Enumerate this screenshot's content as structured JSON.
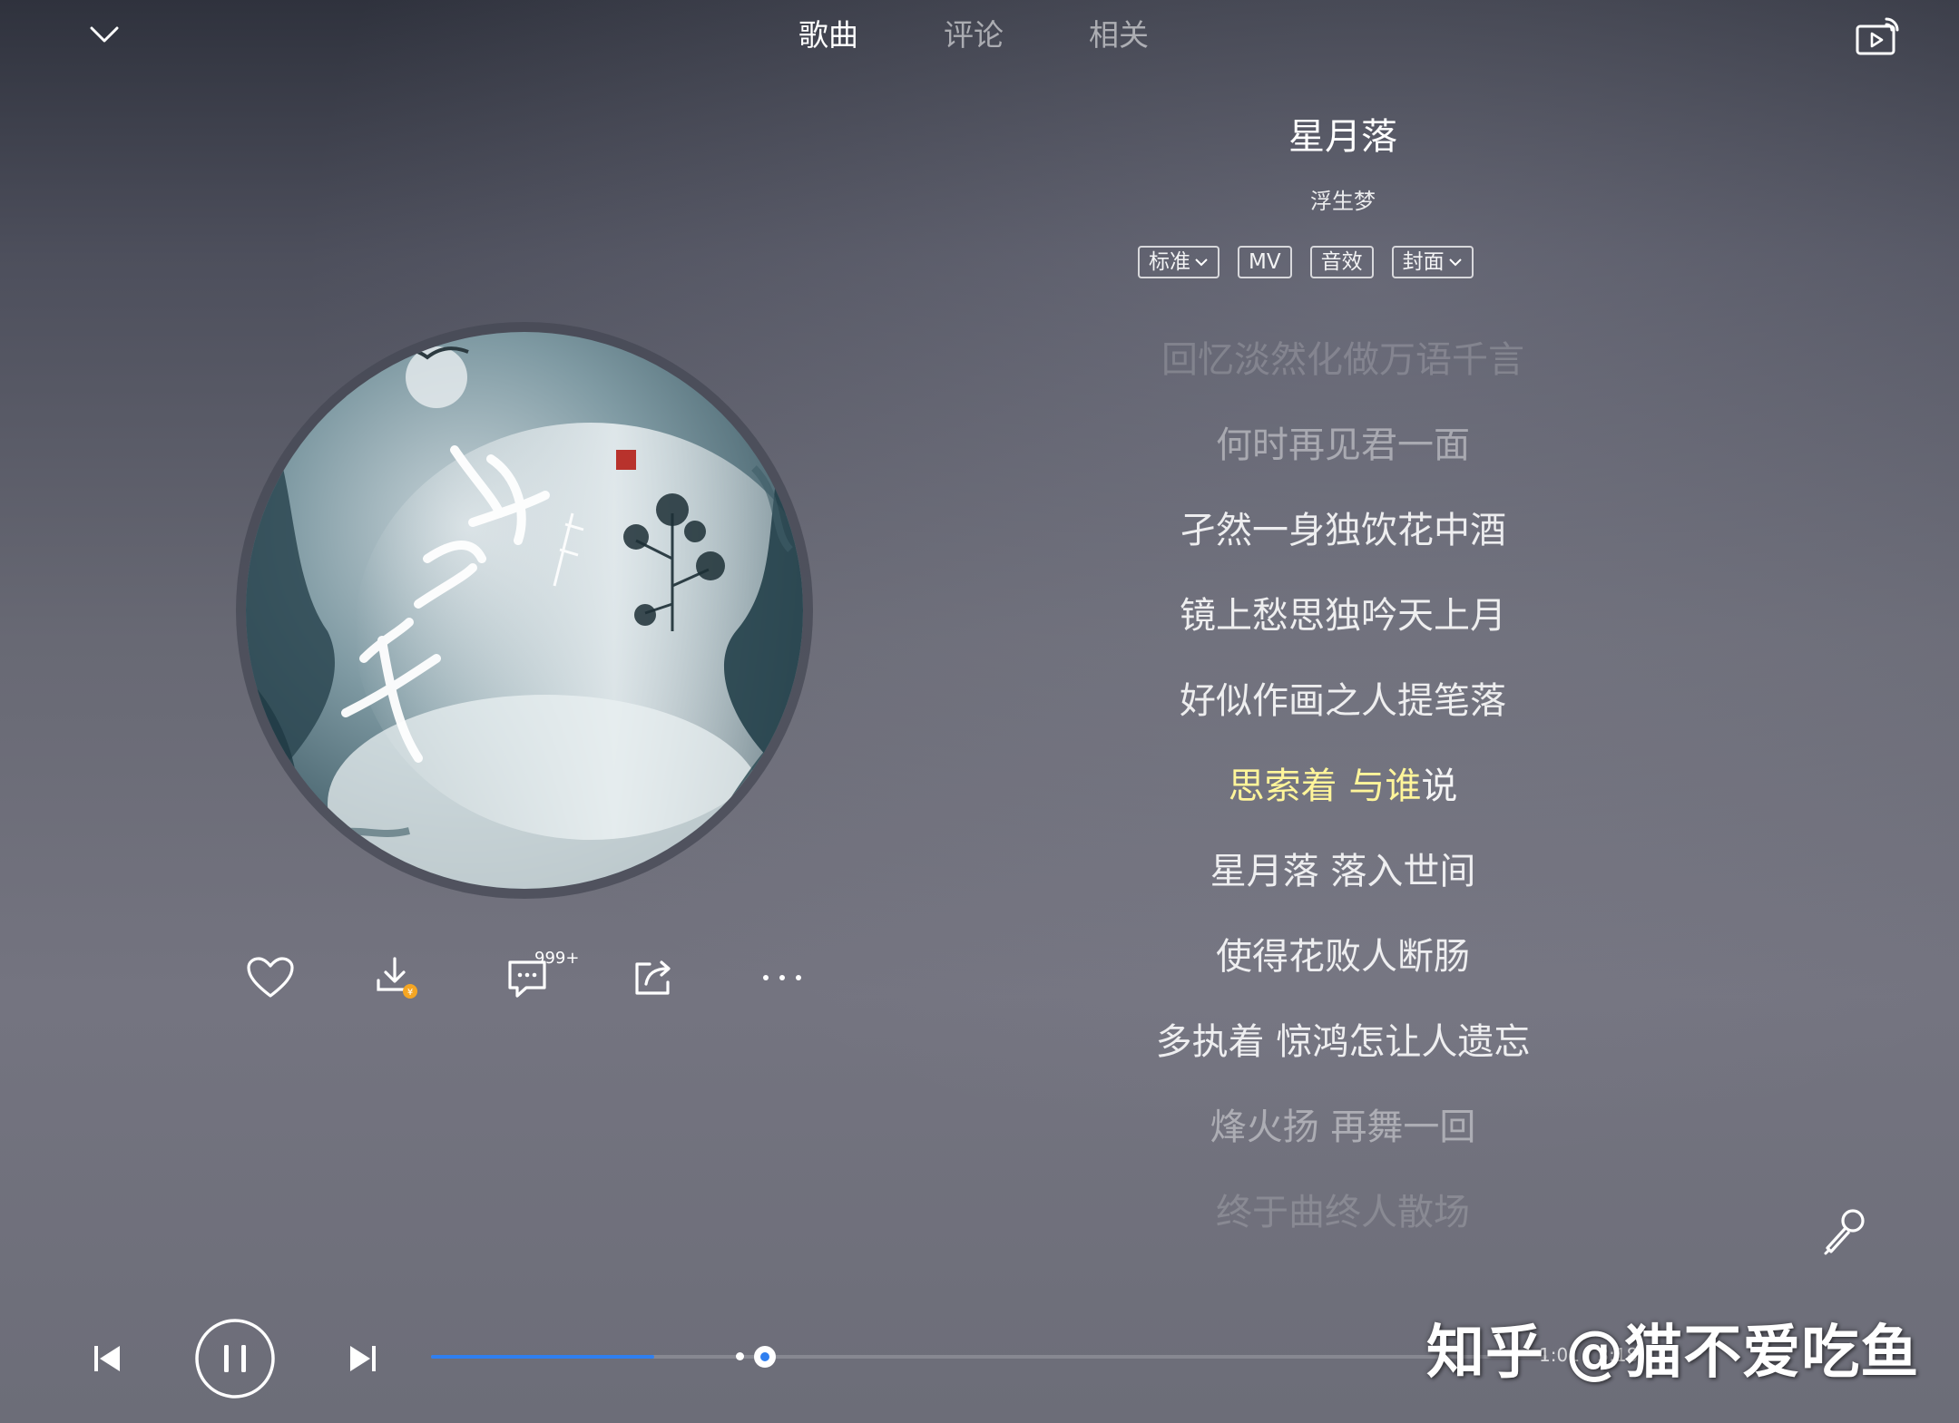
{
  "top_bar": {
    "tabs": [
      {
        "label": "歌曲",
        "active": true
      },
      {
        "label": "评论",
        "active": false
      },
      {
        "label": "相关",
        "active": false
      }
    ],
    "collapse_icon": "chevron-down-icon",
    "cast_icon": "screen-cast-icon"
  },
  "song": {
    "title": "星月落",
    "artist": "浮生梦"
  },
  "tags": [
    {
      "label": "标准",
      "has_dropdown": true
    },
    {
      "label": "MV",
      "has_dropdown": false
    },
    {
      "label": "音效",
      "has_dropdown": false
    },
    {
      "label": "封面",
      "has_dropdown": true
    }
  ],
  "album_art": {
    "calligraphy": "星月落",
    "subtitle": "浮生梦"
  },
  "actions": {
    "comment_count": "999+",
    "icons": [
      "heart-icon",
      "download-icon",
      "comment-icon",
      "share-icon",
      "more-icon"
    ]
  },
  "lyrics": [
    {
      "text": "回忆淡然化做万语千言",
      "state": "faded"
    },
    {
      "text": "何时再见君一面",
      "state": "dim"
    },
    {
      "text": "孑然一身独饮花中酒",
      "state": "normal"
    },
    {
      "text": "镜上愁思独吟天上月",
      "state": "normal"
    },
    {
      "text": "好似作画之人提笔落",
      "state": "normal"
    },
    {
      "text_sung": "思索着 与谁",
      "text_rest": "说",
      "state": "current"
    },
    {
      "text": "星月落 落入世间",
      "state": "normal"
    },
    {
      "text": "使得花败人断肠",
      "state": "normal"
    },
    {
      "text": "多执着 惊鸿怎让人遗忘",
      "state": "normal"
    },
    {
      "text": "烽火扬 再舞一回",
      "state": "dim"
    },
    {
      "text": "终于曲终人散场",
      "state": "faded"
    }
  ],
  "player": {
    "elapsed": "1:01",
    "total": "3:18",
    "time_text": "1:01 / 3:18",
    "progress_fraction": 0.2,
    "accent_color": "#2f7ff0"
  },
  "watermark": "知乎 @猫不爱吃鱼",
  "colors": {
    "current_lyric": "#fff59a",
    "progress": "#2f7ff0"
  }
}
